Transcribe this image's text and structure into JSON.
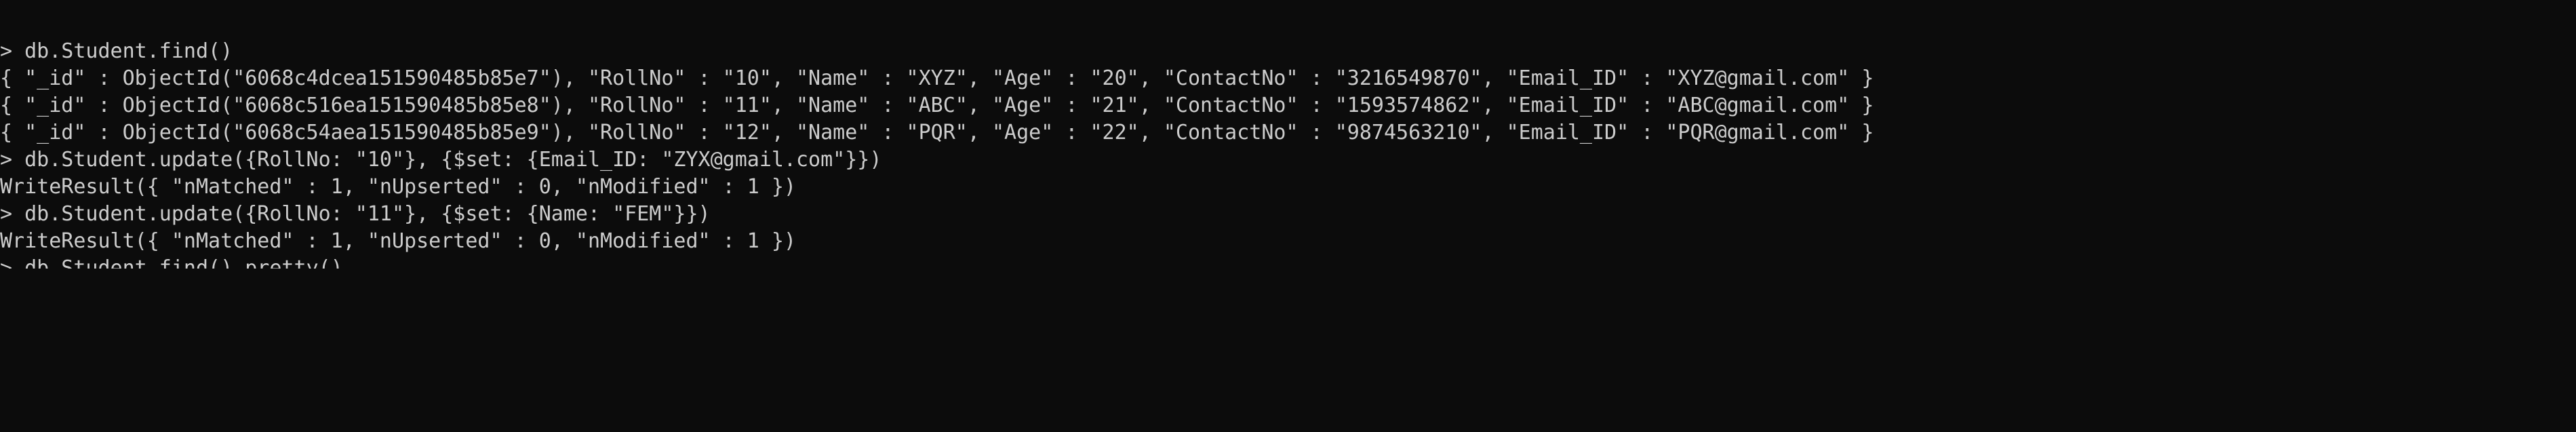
{
  "terminal": {
    "lines": [
      "> db.Student.find()",
      "{ \"_id\" : ObjectId(\"6068c4dcea151590485b85e7\"), \"RollNo\" : \"10\", \"Name\" : \"XYZ\", \"Age\" : \"20\", \"ContactNo\" : \"3216549870\", \"Email_ID\" : \"XYZ@gmail.com\" }",
      "{ \"_id\" : ObjectId(\"6068c516ea151590485b85e8\"), \"RollNo\" : \"11\", \"Name\" : \"ABC\", \"Age\" : \"21\", \"ContactNo\" : \"1593574862\", \"Email_ID\" : \"ABC@gmail.com\" }",
      "{ \"_id\" : ObjectId(\"6068c54aea151590485b85e9\"), \"RollNo\" : \"12\", \"Name\" : \"PQR\", \"Age\" : \"22\", \"ContactNo\" : \"9874563210\", \"Email_ID\" : \"PQR@gmail.com\" }",
      "> db.Student.update({RollNo: \"10\"}, {$set: {Email_ID: \"ZYX@gmail.com\"}})",
      "WriteResult({ \"nMatched\" : 1, \"nUpserted\" : 0, \"nModified\" : 1 })",
      "> db.Student.update({RollNo: \"11\"}, {$set: {Name: \"FEM\"}})",
      "WriteResult({ \"nMatched\" : 1, \"nUpserted\" : 0, \"nModified\" : 1 })",
      "> db.Student.find().pretty()"
    ]
  }
}
